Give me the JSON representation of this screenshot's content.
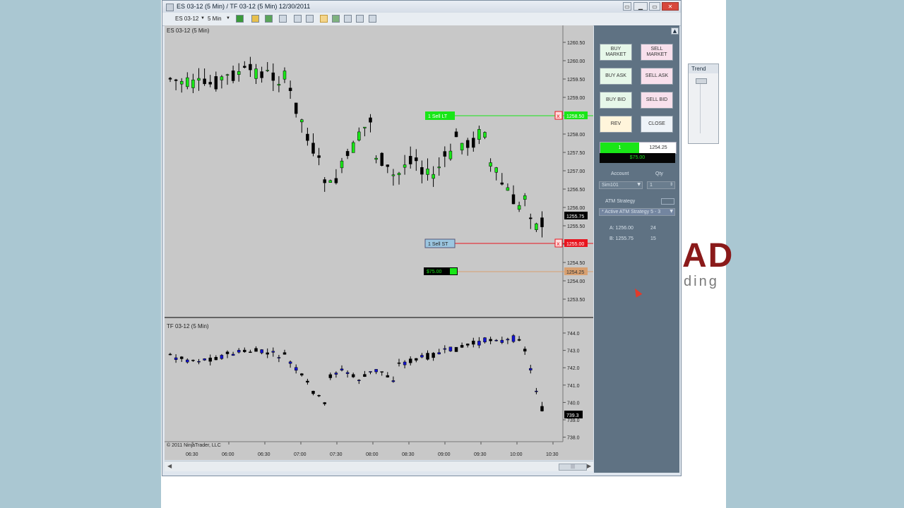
{
  "window": {
    "title": "ES 03-12 (5 Min) / TF 03-12 (5 Min)  12/30/2011",
    "controls": [
      "▁",
      "▭",
      "✕"
    ]
  },
  "toolbar": {
    "instrument": "ES 03-12",
    "interval": "5 Min"
  },
  "charts": {
    "upper_label": "ES 03-12 (5 Min)",
    "lower_label": "TF 03-12 (5 Min)",
    "copyright": "© 2011 NinjaTrader, LLC",
    "time_labels": [
      "06:30",
      "06:00",
      "06:30",
      "07:00",
      "07:30",
      "08:00",
      "08:30",
      "09:00",
      "09:30",
      "10:00",
      "10:30"
    ],
    "upper_price_labels": [
      "1260.50",
      "1260.00",
      "1259.50",
      "1259.00",
      "1258.50",
      "1258.00",
      "1257.50",
      "1257.00",
      "1256.50",
      "1256.00",
      "1255.50",
      "1255.00",
      "1254.50",
      "1254.00",
      "1253.50"
    ],
    "lower_price_labels": [
      "744.0",
      "743.0",
      "742.0",
      "741.0",
      "740.0",
      "739.0",
      "738.0"
    ],
    "orders": {
      "sell_target_label": "1  Sell  LT",
      "sell_target_price": "1258.50",
      "sell_stop_label": "1  Sell  ST",
      "sell_stop_price": "1255.00",
      "position_label": "$75.00",
      "position_price": "1254.25",
      "last_price_upper": "1255.75",
      "last_price_lower": "739.3"
    }
  },
  "chart_trader": {
    "buy_market": "BUY MARKET",
    "sell_market": "SELL MARKET",
    "buy_ask": "BUY ASK",
    "sell_ask": "SELL ASK",
    "buy_bid": "BUY BID",
    "sell_bid": "SELL BID",
    "rev": "REV",
    "close": "CLOSE",
    "position_qty": "1",
    "position_price": "1254.25",
    "pnl": "$75.00",
    "account_label": "Account",
    "account_value": "Sim101",
    "qty_label": "Qty",
    "qty_value": "1",
    "atm_label": "ATM Strategy",
    "atm_value": "* Active ATM Strategy 5 - 3",
    "level_a": "A: 1256.00",
    "level_a_qty": "24",
    "level_b": "B: 1255.75",
    "level_b_qty": "15"
  },
  "background": {
    "trend_window_title": "Trend",
    "logo_text": "AD",
    "logo_sub": "ding"
  },
  "colors": {
    "chart_bg": "#c8c8c8",
    "up_candle_upper": "#19e617",
    "up_candle_lower": "#1414d2",
    "down_candle": "#000000",
    "target_line": "#19e617",
    "stop_line": "#e8141e",
    "panel_bg": "#5f7283"
  }
}
